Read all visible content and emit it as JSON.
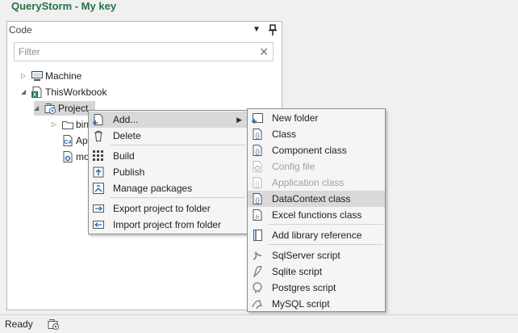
{
  "window": {
    "title": "QueryStorm - My key"
  },
  "panel": {
    "title": "Code",
    "filter_placeholder": "Filter",
    "clear_glyph": "✕",
    "dropdown_glyph": "▼",
    "pin_glyph": "📌"
  },
  "tree": {
    "machine": "Machine",
    "workbook": "ThisWorkbook",
    "project": "Project",
    "bin": "bin",
    "app": "Ap",
    "module": "mo"
  },
  "context_menu": {
    "items": [
      {
        "label": "Add...",
        "icon": "add-icon",
        "submenu": true,
        "highlighted": true
      },
      {
        "label": "Delete",
        "icon": "trash-icon"
      },
      {
        "label": "Build",
        "icon": "build-icon"
      },
      {
        "label": "Publish",
        "icon": "publish-icon"
      },
      {
        "label": "Manage packages",
        "icon": "package-icon"
      },
      {
        "label": "Export project to folder",
        "icon": "export-icon"
      },
      {
        "label": "Import project from folder",
        "icon": "import-icon"
      }
    ]
  },
  "submenu": {
    "items": [
      {
        "label": "New folder",
        "icon": "new-folder-icon"
      },
      {
        "label": "Class",
        "icon": "class-icon"
      },
      {
        "label": "Component class",
        "icon": "class-icon"
      },
      {
        "label": "Config file",
        "icon": "config-icon",
        "disabled": true
      },
      {
        "label": "Application class",
        "icon": "class-icon",
        "disabled": true
      },
      {
        "label": "DataContext class",
        "icon": "class-icon",
        "highlighted": true
      },
      {
        "label": "Excel functions class",
        "icon": "function-icon"
      },
      {
        "label": "Add library reference",
        "icon": "library-icon"
      },
      {
        "label": "SqlServer script",
        "icon": "sqlserver-icon"
      },
      {
        "label": "Sqlite script",
        "icon": "sqlite-icon"
      },
      {
        "label": "Postgres script",
        "icon": "postgres-icon"
      },
      {
        "label": "MySQL script",
        "icon": "mysql-icon"
      }
    ]
  },
  "status": {
    "text": "Ready"
  },
  "colors": {
    "brand": "#217346",
    "highlight": "#d9d9d9",
    "icon_blue": "#2b6cb0"
  }
}
